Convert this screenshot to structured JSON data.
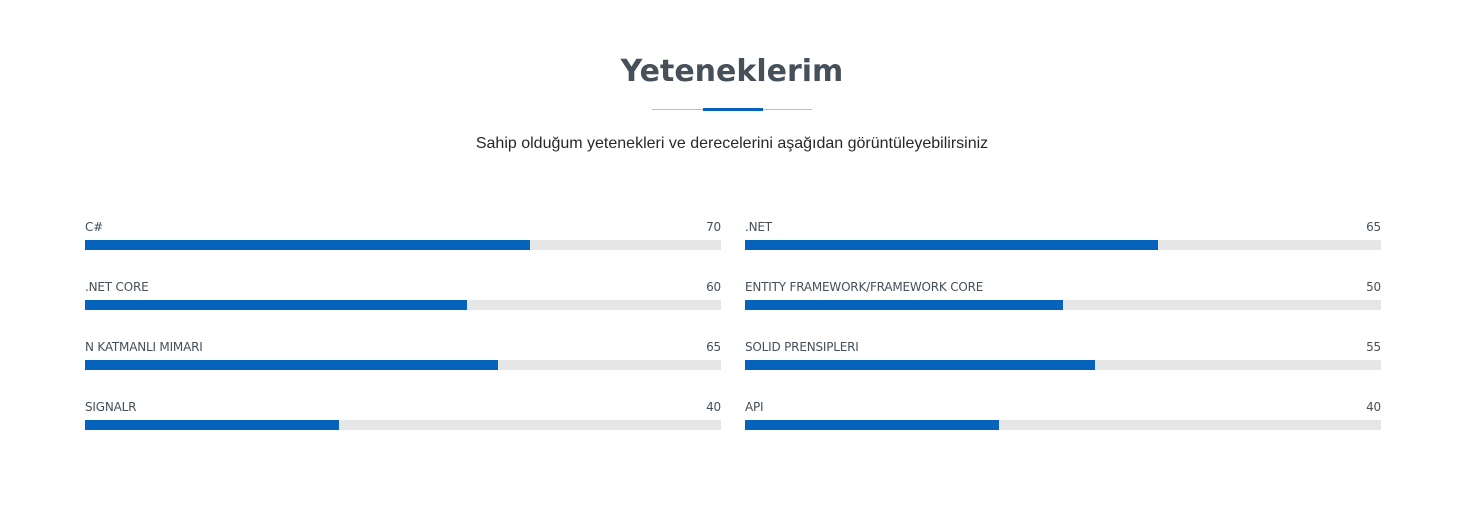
{
  "section": {
    "title": "Yeteneklerim",
    "subtitle": "Sahip olduğum yetenekleri ve derecelerini aşağıdan görüntüleyebilirsiniz"
  },
  "colors": {
    "accent": "#0563bb",
    "track": "#e6e6e6",
    "heading": "#45505b"
  },
  "skills": {
    "left": [
      {
        "name": "C#",
        "value": "70",
        "percent": 70
      },
      {
        "name": ".NET CORE",
        "value": "60",
        "percent": 60
      },
      {
        "name": "N KATMANLI MIMARI",
        "value": "65",
        "percent": 65
      },
      {
        "name": "SIGNALR",
        "value": "40",
        "percent": 40
      }
    ],
    "right": [
      {
        "name": ".NET",
        "value": "65",
        "percent": 65
      },
      {
        "name": "ENTITY FRAMEWORK/FRAMEWORK CORE",
        "value": "50",
        "percent": 50
      },
      {
        "name": "SOLID PRENSIPLERI",
        "value": "55",
        "percent": 55
      },
      {
        "name": "API",
        "value": "40",
        "percent": 40
      }
    ]
  }
}
